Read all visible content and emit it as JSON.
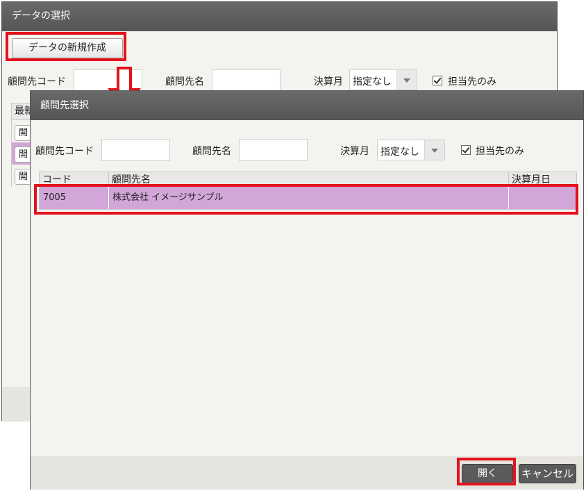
{
  "back_window": {
    "title": "データの選択",
    "new_button": "データの新規作成",
    "filters": {
      "code_label": "顧問先コード",
      "name_label": "顧問先名",
      "month_label": "決算月",
      "month_value": "指定なし",
      "assigned_only_label": "担当先のみ"
    },
    "table_header_fragment": "最新",
    "row_fragments": [
      "開",
      "開",
      "開"
    ]
  },
  "front_window": {
    "title": "顧問先選択",
    "filters": {
      "code_label": "顧問先コード",
      "name_label": "顧問先名",
      "month_label": "決算月",
      "month_value": "指定なし",
      "assigned_only_label": "担当先のみ"
    },
    "table": {
      "columns": [
        "コード",
        "顧問先名",
        "決算月日"
      ],
      "rows": [
        {
          "code": "7005",
          "name": "株式会社 イメージサンプル",
          "closing_date": ""
        }
      ]
    },
    "open_button": "開く",
    "cancel_button": "キャンセル"
  },
  "colors": {
    "highlight": "#e3121c",
    "selected_row": "#d2a6d8",
    "titlebar": "#5e5e5e"
  }
}
